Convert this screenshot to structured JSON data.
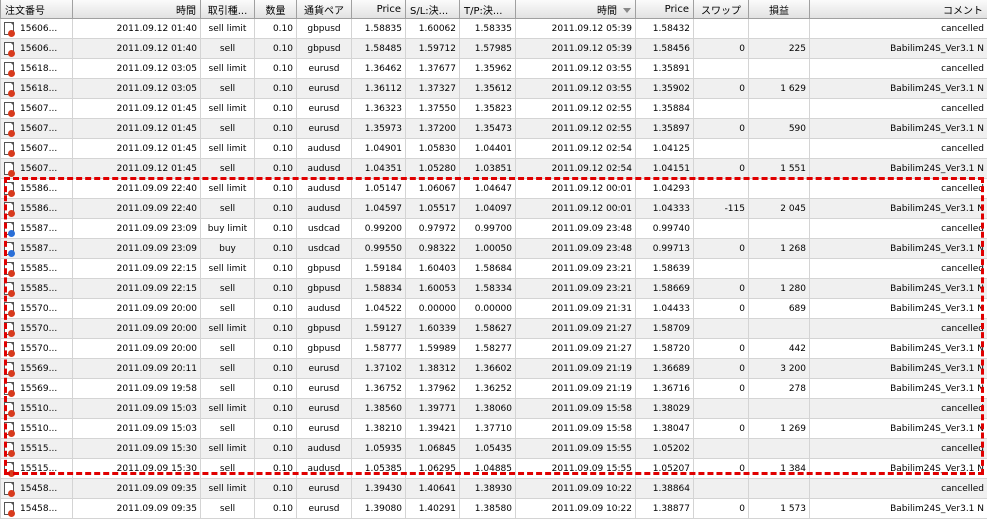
{
  "columns": [
    "注文番号",
    "時間",
    "取引種...",
    "数量",
    "通貨ペア",
    "Price",
    "S/L:決...",
    "T/P:決...",
    "時間",
    "Price",
    "スワップ",
    "損益",
    "コメント"
  ],
  "colors": {
    "sell_dot": "#d83a1c",
    "buy_dot": "#2a6fd8",
    "highlight": "#e00000"
  },
  "rows": [
    {
      "dir": "sell",
      "cells": [
        "15606...",
        "2011.09.12 01:40",
        "sell limit",
        "0.10",
        "gbpusd",
        "1.58835",
        "1.60062",
        "1.58335",
        "2011.09.12 05:39",
        "1.58432",
        "",
        "",
        "cancelled"
      ]
    },
    {
      "dir": "sell",
      "cells": [
        "15606...",
        "2011.09.12 01:40",
        "sell",
        "0.10",
        "gbpusd",
        "1.58485",
        "1.59712",
        "1.57985",
        "2011.09.12 05:39",
        "1.58456",
        "0",
        "225",
        "Babilim24S_Ver3.1 N"
      ]
    },
    {
      "dir": "sell",
      "cells": [
        "15618...",
        "2011.09.12 03:05",
        "sell limit",
        "0.10",
        "eurusd",
        "1.36462",
        "1.37677",
        "1.35962",
        "2011.09.12 03:55",
        "1.35891",
        "",
        "",
        "cancelled"
      ]
    },
    {
      "dir": "sell",
      "cells": [
        "15618...",
        "2011.09.12 03:05",
        "sell",
        "0.10",
        "eurusd",
        "1.36112",
        "1.37327",
        "1.35612",
        "2011.09.12 03:55",
        "1.35902",
        "0",
        "1 629",
        "Babilim24S_Ver3.1 N"
      ]
    },
    {
      "dir": "sell",
      "cells": [
        "15607...",
        "2011.09.12 01:45",
        "sell limit",
        "0.10",
        "eurusd",
        "1.36323",
        "1.37550",
        "1.35823",
        "2011.09.12 02:55",
        "1.35884",
        "",
        "",
        "cancelled"
      ]
    },
    {
      "dir": "sell",
      "cells": [
        "15607...",
        "2011.09.12 01:45",
        "sell",
        "0.10",
        "eurusd",
        "1.35973",
        "1.37200",
        "1.35473",
        "2011.09.12 02:55",
        "1.35897",
        "0",
        "590",
        "Babilim24S_Ver3.1 N"
      ]
    },
    {
      "dir": "sell",
      "cells": [
        "15607...",
        "2011.09.12 01:45",
        "sell limit",
        "0.10",
        "audusd",
        "1.04901",
        "1.05830",
        "1.04401",
        "2011.09.12 02:54",
        "1.04125",
        "",
        "",
        "cancelled"
      ]
    },
    {
      "dir": "sell",
      "cells": [
        "15607...",
        "2011.09.12 01:45",
        "sell",
        "0.10",
        "audusd",
        "1.04351",
        "1.05280",
        "1.03851",
        "2011.09.12 02:54",
        "1.04151",
        "0",
        "1 551",
        "Babilim24S_Ver3.1 N"
      ]
    },
    {
      "dir": "sell",
      "cells": [
        "15586...",
        "2011.09.09 22:40",
        "sell limit",
        "0.10",
        "audusd",
        "1.05147",
        "1.06067",
        "1.04647",
        "2011.09.12 00:01",
        "1.04293",
        "",
        "",
        "cancelled"
      ]
    },
    {
      "dir": "sell",
      "cells": [
        "15586...",
        "2011.09.09 22:40",
        "sell",
        "0.10",
        "audusd",
        "1.04597",
        "1.05517",
        "1.04097",
        "2011.09.12 00:01",
        "1.04333",
        "-115",
        "2 045",
        "Babilim24S_Ver3.1 N"
      ]
    },
    {
      "dir": "buy",
      "cells": [
        "15587...",
        "2011.09.09 23:09",
        "buy limit",
        "0.10",
        "usdcad",
        "0.99200",
        "0.97972",
        "0.99700",
        "2011.09.09 23:48",
        "0.99740",
        "",
        "",
        "cancelled"
      ]
    },
    {
      "dir": "buy",
      "cells": [
        "15587...",
        "2011.09.09 23:09",
        "buy",
        "0.10",
        "usdcad",
        "0.99550",
        "0.98322",
        "1.00050",
        "2011.09.09 23:48",
        "0.99713",
        "0",
        "1 268",
        "Babilim24S_Ver3.1 N"
      ]
    },
    {
      "dir": "sell",
      "cells": [
        "15585...",
        "2011.09.09 22:15",
        "sell limit",
        "0.10",
        "gbpusd",
        "1.59184",
        "1.60403",
        "1.58684",
        "2011.09.09 23:21",
        "1.58639",
        "",
        "",
        "cancelled"
      ]
    },
    {
      "dir": "sell",
      "cells": [
        "15585...",
        "2011.09.09 22:15",
        "sell",
        "0.10",
        "gbpusd",
        "1.58834",
        "1.60053",
        "1.58334",
        "2011.09.09 23:21",
        "1.58669",
        "0",
        "1 280",
        "Babilim24S_Ver3.1 N"
      ]
    },
    {
      "dir": "sell",
      "cells": [
        "15570...",
        "2011.09.09 20:00",
        "sell",
        "0.10",
        "audusd",
        "1.04522",
        "0.00000",
        "0.00000",
        "2011.09.09 21:31",
        "1.04433",
        "0",
        "689",
        "Babilim24S_Ver3.1 N"
      ]
    },
    {
      "dir": "sell",
      "cells": [
        "15570...",
        "2011.09.09 20:00",
        "sell limit",
        "0.10",
        "gbpusd",
        "1.59127",
        "1.60339",
        "1.58627",
        "2011.09.09 21:27",
        "1.58709",
        "",
        "",
        "cancelled"
      ]
    },
    {
      "dir": "sell",
      "cells": [
        "15570...",
        "2011.09.09 20:00",
        "sell",
        "0.10",
        "gbpusd",
        "1.58777",
        "1.59989",
        "1.58277",
        "2011.09.09 21:27",
        "1.58720",
        "0",
        "442",
        "Babilim24S_Ver3.1 N"
      ]
    },
    {
      "dir": "sell",
      "cells": [
        "15569...",
        "2011.09.09 20:11",
        "sell",
        "0.10",
        "eurusd",
        "1.37102",
        "1.38312",
        "1.36602",
        "2011.09.09 21:19",
        "1.36689",
        "0",
        "3 200",
        "Babilim24S_Ver3.1 N"
      ]
    },
    {
      "dir": "sell",
      "cells": [
        "15569...",
        "2011.09.09 19:58",
        "sell",
        "0.10",
        "eurusd",
        "1.36752",
        "1.37962",
        "1.36252",
        "2011.09.09 21:19",
        "1.36716",
        "0",
        "278",
        "Babilim24S_Ver3.1 N"
      ]
    },
    {
      "dir": "sell",
      "cells": [
        "15510...",
        "2011.09.09 15:03",
        "sell limit",
        "0.10",
        "eurusd",
        "1.38560",
        "1.39771",
        "1.38060",
        "2011.09.09 15:58",
        "1.38029",
        "",
        "",
        "cancelled"
      ]
    },
    {
      "dir": "sell",
      "cells": [
        "15510...",
        "2011.09.09 15:03",
        "sell",
        "0.10",
        "eurusd",
        "1.38210",
        "1.39421",
        "1.37710",
        "2011.09.09 15:58",
        "1.38047",
        "0",
        "1 269",
        "Babilim24S_Ver3.1 N"
      ]
    },
    {
      "dir": "sell",
      "cells": [
        "15515...",
        "2011.09.09 15:30",
        "sell limit",
        "0.10",
        "audusd",
        "1.05935",
        "1.06845",
        "1.05435",
        "2011.09.09 15:55",
        "1.05202",
        "",
        "",
        "cancelled"
      ]
    },
    {
      "dir": "sell",
      "cells": [
        "15515...",
        "2011.09.09 15:30",
        "sell",
        "0.10",
        "audusd",
        "1.05385",
        "1.06295",
        "1.04885",
        "2011.09.09 15:55",
        "1.05207",
        "0",
        "1 384",
        "Babilim24S_Ver3.1 N"
      ]
    },
    {
      "dir": "sell",
      "cells": [
        "15458...",
        "2011.09.09 09:35",
        "sell limit",
        "0.10",
        "eurusd",
        "1.39430",
        "1.40641",
        "1.38930",
        "2011.09.09 10:22",
        "1.38864",
        "",
        "",
        "cancelled"
      ]
    },
    {
      "dir": "sell",
      "cells": [
        "15458...",
        "2011.09.09 09:35",
        "sell",
        "0.10",
        "eurusd",
        "1.39080",
        "1.40291",
        "1.38580",
        "2011.09.09 10:22",
        "1.38877",
        "0",
        "1 573",
        "Babilim24S_Ver3.1 N"
      ]
    }
  ]
}
